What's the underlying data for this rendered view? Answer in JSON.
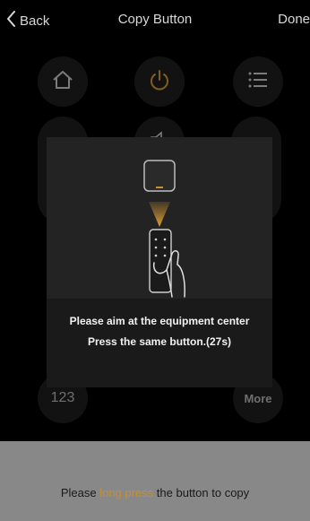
{
  "header": {
    "back_label": "Back",
    "title": "Copy Button",
    "done_label": "Done"
  },
  "remote": {
    "numeric_label": "123",
    "more_label": "More"
  },
  "modal": {
    "line1": "Please aim at the equipment center",
    "line2": "Press the same button.(27s)"
  },
  "hint": {
    "prefix": "Please ",
    "accent": "long press",
    "suffix": " the button to copy"
  },
  "colors": {
    "accent": "#c8902f",
    "power": "#c8902f"
  }
}
